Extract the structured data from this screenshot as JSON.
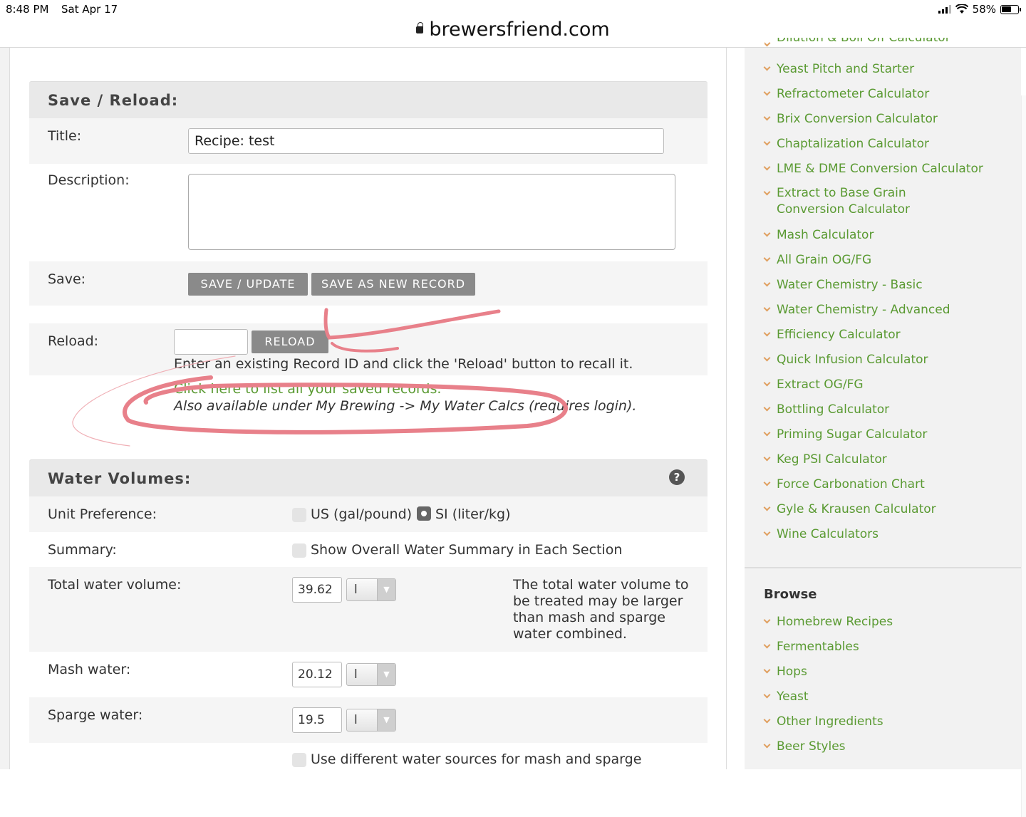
{
  "status_bar": {
    "time": "8:48 PM",
    "date": "Sat Apr 17",
    "battery": "58%"
  },
  "browser": {
    "domain": "brewersfriend.com"
  },
  "save_reload": {
    "heading": "Save / Reload:",
    "title_label": "Title:",
    "title_value": "Recipe: test",
    "description_label": "Description:",
    "save_label": "Save:",
    "save_update_button": "SAVE / UPDATE",
    "save_new_button": "SAVE AS NEW RECORD",
    "reload_label": "Reload:",
    "reload_button": "RELOAD",
    "reload_hint": "Enter an existing Record ID and click the 'Reload' button to recall it.",
    "list_link": "Click here to list all your saved records.",
    "also_available": "Also available under My Brewing -> My Water Calcs (requires login)."
  },
  "water_volumes": {
    "heading": "Water Volumes:",
    "help_icon": "?",
    "unit_pref_label": "Unit Preference:",
    "unit_us": "US (gal/pound)",
    "unit_si": "SI (liter/kg)",
    "selected_unit": "SI",
    "summary_label": "Summary:",
    "summary_option": "Show Overall Water Summary in Each Section",
    "total_label": "Total water volume:",
    "total_value": "39.62",
    "total_unit": "l",
    "total_note": "The total water volume to be treated may be larger than mash and sparge water combined.",
    "mash_label": "Mash water:",
    "mash_value": "20.12",
    "mash_unit": "l",
    "sparge_label": "Sparge water:",
    "sparge_value": "19.5",
    "sparge_unit": "l",
    "different_sources": "Use different water sources for mash and sparge"
  },
  "sidebar": {
    "cut_off_item": "Dilution & Boil Off Calculator",
    "calculators": [
      "Yeast Pitch and Starter",
      "Refractometer Calculator",
      "Brix Conversion Calculator",
      "Chaptalization Calculator",
      "LME & DME Conversion Calculator",
      "Extract to Base Grain Conversion Calculator",
      "Mash Calculator",
      "All Grain OG/FG",
      "Water Chemistry - Basic",
      "Water Chemistry - Advanced",
      "Efficiency Calculator",
      "Quick Infusion Calculator",
      "Extract OG/FG",
      "Bottling Calculator",
      "Priming Sugar Calculator",
      "Keg PSI Calculator",
      "Force Carbonation Chart",
      "Gyle & Krausen Calculator",
      "Wine Calculators"
    ],
    "browse_heading": "Browse",
    "browse": [
      "Homebrew Recipes",
      "Fermentables",
      "Hops",
      "Yeast",
      "Other Ingredients",
      "Beer Styles"
    ]
  },
  "colors": {
    "link": "#5a9a32",
    "button": "#8a8a8a",
    "annotation": "#e8808a"
  }
}
